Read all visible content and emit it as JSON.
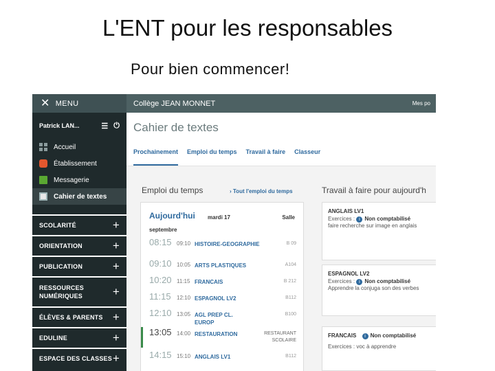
{
  "slide": {
    "title": "L'ENT pour les responsables",
    "subtitle": "Pour bien commencer!"
  },
  "sidebar": {
    "menu_label": "MENU",
    "user_name": "Patrick LAN...",
    "items": [
      {
        "label": "Accueil",
        "icon": "dashboard-icon"
      },
      {
        "label": "Établissement",
        "icon": "house-icon"
      },
      {
        "label": "Messagerie",
        "icon": "mail-icon"
      },
      {
        "label": "Cahier de textes",
        "icon": "book-icon",
        "active": true
      }
    ],
    "sections": [
      {
        "label": "SCOLARITÉ"
      },
      {
        "label": "ORIENTATION"
      },
      {
        "label": "PUBLICATION"
      },
      {
        "label": "RESSOURCES NUMÉRIQUES"
      },
      {
        "label": "ÉLÈVES & PARENTS"
      },
      {
        "label": "EDULINE"
      },
      {
        "label": "ESPACE DES CLASSES"
      }
    ]
  },
  "topbar": {
    "school": "Collège JEAN MONNET",
    "right_text": "Mes po"
  },
  "page": {
    "title": "Cahier de textes",
    "tabs": [
      {
        "label": "Prochainement",
        "active": true
      },
      {
        "label": "Emploi du temps"
      },
      {
        "label": "Travail à faire"
      },
      {
        "label": "Classeur"
      }
    ]
  },
  "timetable": {
    "section_title": "Emploi du temps",
    "link": "› Tout l'emploi du temps",
    "today": "Aujourd'hui",
    "month": "septembre",
    "day": "mardi 17",
    "room_header": "Salle",
    "rows": [
      {
        "start": "08:15",
        "end": "09:10",
        "subject": "HISTOIRE-GEOGRAPHIE",
        "room": "B 09"
      },
      {
        "start": "09:10",
        "end": "10:05",
        "subject": "ARTS PLASTIQUES",
        "room": "A104"
      },
      {
        "start": "10:20",
        "end": "11:15",
        "subject": "FRANCAIS",
        "room": "B 212"
      },
      {
        "start": "11:15",
        "end": "12:10",
        "subject": "ESPAGNOL LV2",
        "room": "B112"
      },
      {
        "start": "12:10",
        "end": "13:05",
        "subject": "AGL PREP CL. EUROP",
        "room": "B100"
      },
      {
        "start": "13:05",
        "end": "14:00",
        "subject": "RESTAURATION",
        "room": "RESTAURANT SCOLAIRE",
        "current": true
      },
      {
        "start": "14:15",
        "end": "15:10",
        "subject": "ANGLAIS LV1",
        "room": "B112"
      }
    ]
  },
  "tasks": {
    "section_title": "Travail à faire pour aujourd'h",
    "items": [
      {
        "subject": "ANGLAIS LV1",
        "badge": "Non comptabilisé",
        "label": "Exercices :",
        "text": "faire recherche sur image en anglais"
      },
      {
        "subject": "ESPAGNOL LV2",
        "badge": "Non comptabilisé",
        "label": "Exercices :",
        "text": "Apprendre la conjuga son des verbes"
      },
      {
        "subject": "FRANCAIS",
        "badge": "Non comptabilisé",
        "label": "",
        "text": "Exercices : voc à apprendre"
      }
    ]
  }
}
